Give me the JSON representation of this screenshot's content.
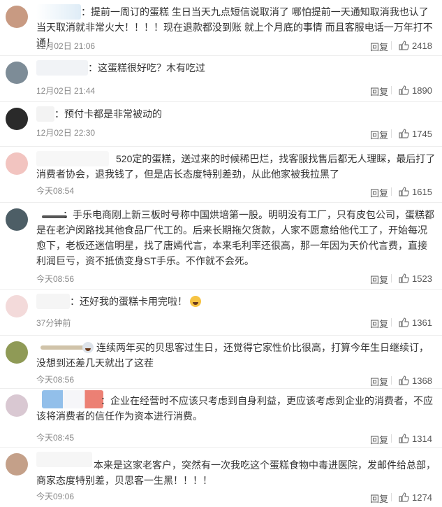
{
  "comments": [
    {
      "text": "：提前一周订的蛋糕 生日当天九点短信说取消了 哪怕提前一天通知取消我也认了 当天取消就非常火大！！！！现在退款都没到账 就上个月底的事情 而且客服电话一万年打不通！",
      "time": "12月02日 21:06",
      "reply": "回复",
      "likes": "2418",
      "avatar_color": "#c89a82",
      "name_color": "#d9e9f5"
    },
    {
      "text": "：这蛋糕很好吃？木有吃过",
      "time": "12月02日 21:44",
      "reply": "回复",
      "likes": "1890",
      "avatar_color": "#7d8c97",
      "name_color": "#eef1f4"
    },
    {
      "text": "：预付卡都是非常被动的",
      "time": "12月02日 22:30",
      "reply": "回复",
      "likes": "1745",
      "avatar_color": "#2a2a2a",
      "name_color": "#f1f1f1"
    },
    {
      "text": "520定的蛋糕，送过来的时候稀巴烂，找客服找售后都无人理睬，最后打了消费者协会，退我钱了，但是店长态度特别差劲，从此他家被我拉黑了",
      "time": "今天08:54",
      "reply": "回复",
      "likes": "1615",
      "avatar_color": "#f2c4c0",
      "name_color": "#f6f6f6"
    },
    {
      "text": "：手乐电商刚上新三板时号称中国烘培第一股。明明没有工厂，只有皮包公司，蛋糕都是在老沪闵路找其他食品厂代工的。后来长期拖欠货款，人家不愿意给他代工了，开始每况愈下，老板还迷信明星，找了唐嫣代言，本来毛利率还很高，那一年因为天价代言费，直接利润巨亏，资不抵债变身ST手乐。不作就不会死。",
      "time": "今天08:56",
      "reply": "回复",
      "likes": "1523",
      "avatar_color": "#4d5e66",
      "name_color": "#3a3a3a"
    },
    {
      "text": "：还好我的蛋糕卡用完啦！",
      "time": "37分钟前",
      "reply": "回复",
      "likes": "1361",
      "avatar_color": "#f3dada",
      "name_color": "#f3f3f3"
    },
    {
      "text": "连续两年买的贝思客过生日，还觉得它家性价比很高，打算今年生日继续订，没想到还差几天就出了这茬",
      "time": "今天08:56",
      "reply": "回复",
      "likes": "1368",
      "avatar_color": "#8f9a56",
      "name_color": "#c8b99a"
    },
    {
      "text": "：企业在经营时不应该只考虑到自身利益，更应该考虑到企业的消费者，不应该将消费者的信任作为资本进行消费。",
      "time": "今天08:45",
      "reply": "回复",
      "likes": "1314",
      "avatar_color": "#d9c8d2",
      "name_color": "#e7e7f2"
    },
    {
      "text": "本来是这家老客户，突然有一次我吃这个蛋糕食物中毒进医院，发邮件给总部，商家态度特别差，贝思客一生黑！！！！",
      "time": "今天09:06",
      "reply": "回复",
      "likes": "1274",
      "avatar_color": "#c4a089",
      "name_color": "#f5f5f5"
    }
  ],
  "icons": {
    "like": "thumbs-up-icon",
    "emoji": "laughing-emoji-icon",
    "badge": "vip-badge-icon"
  }
}
